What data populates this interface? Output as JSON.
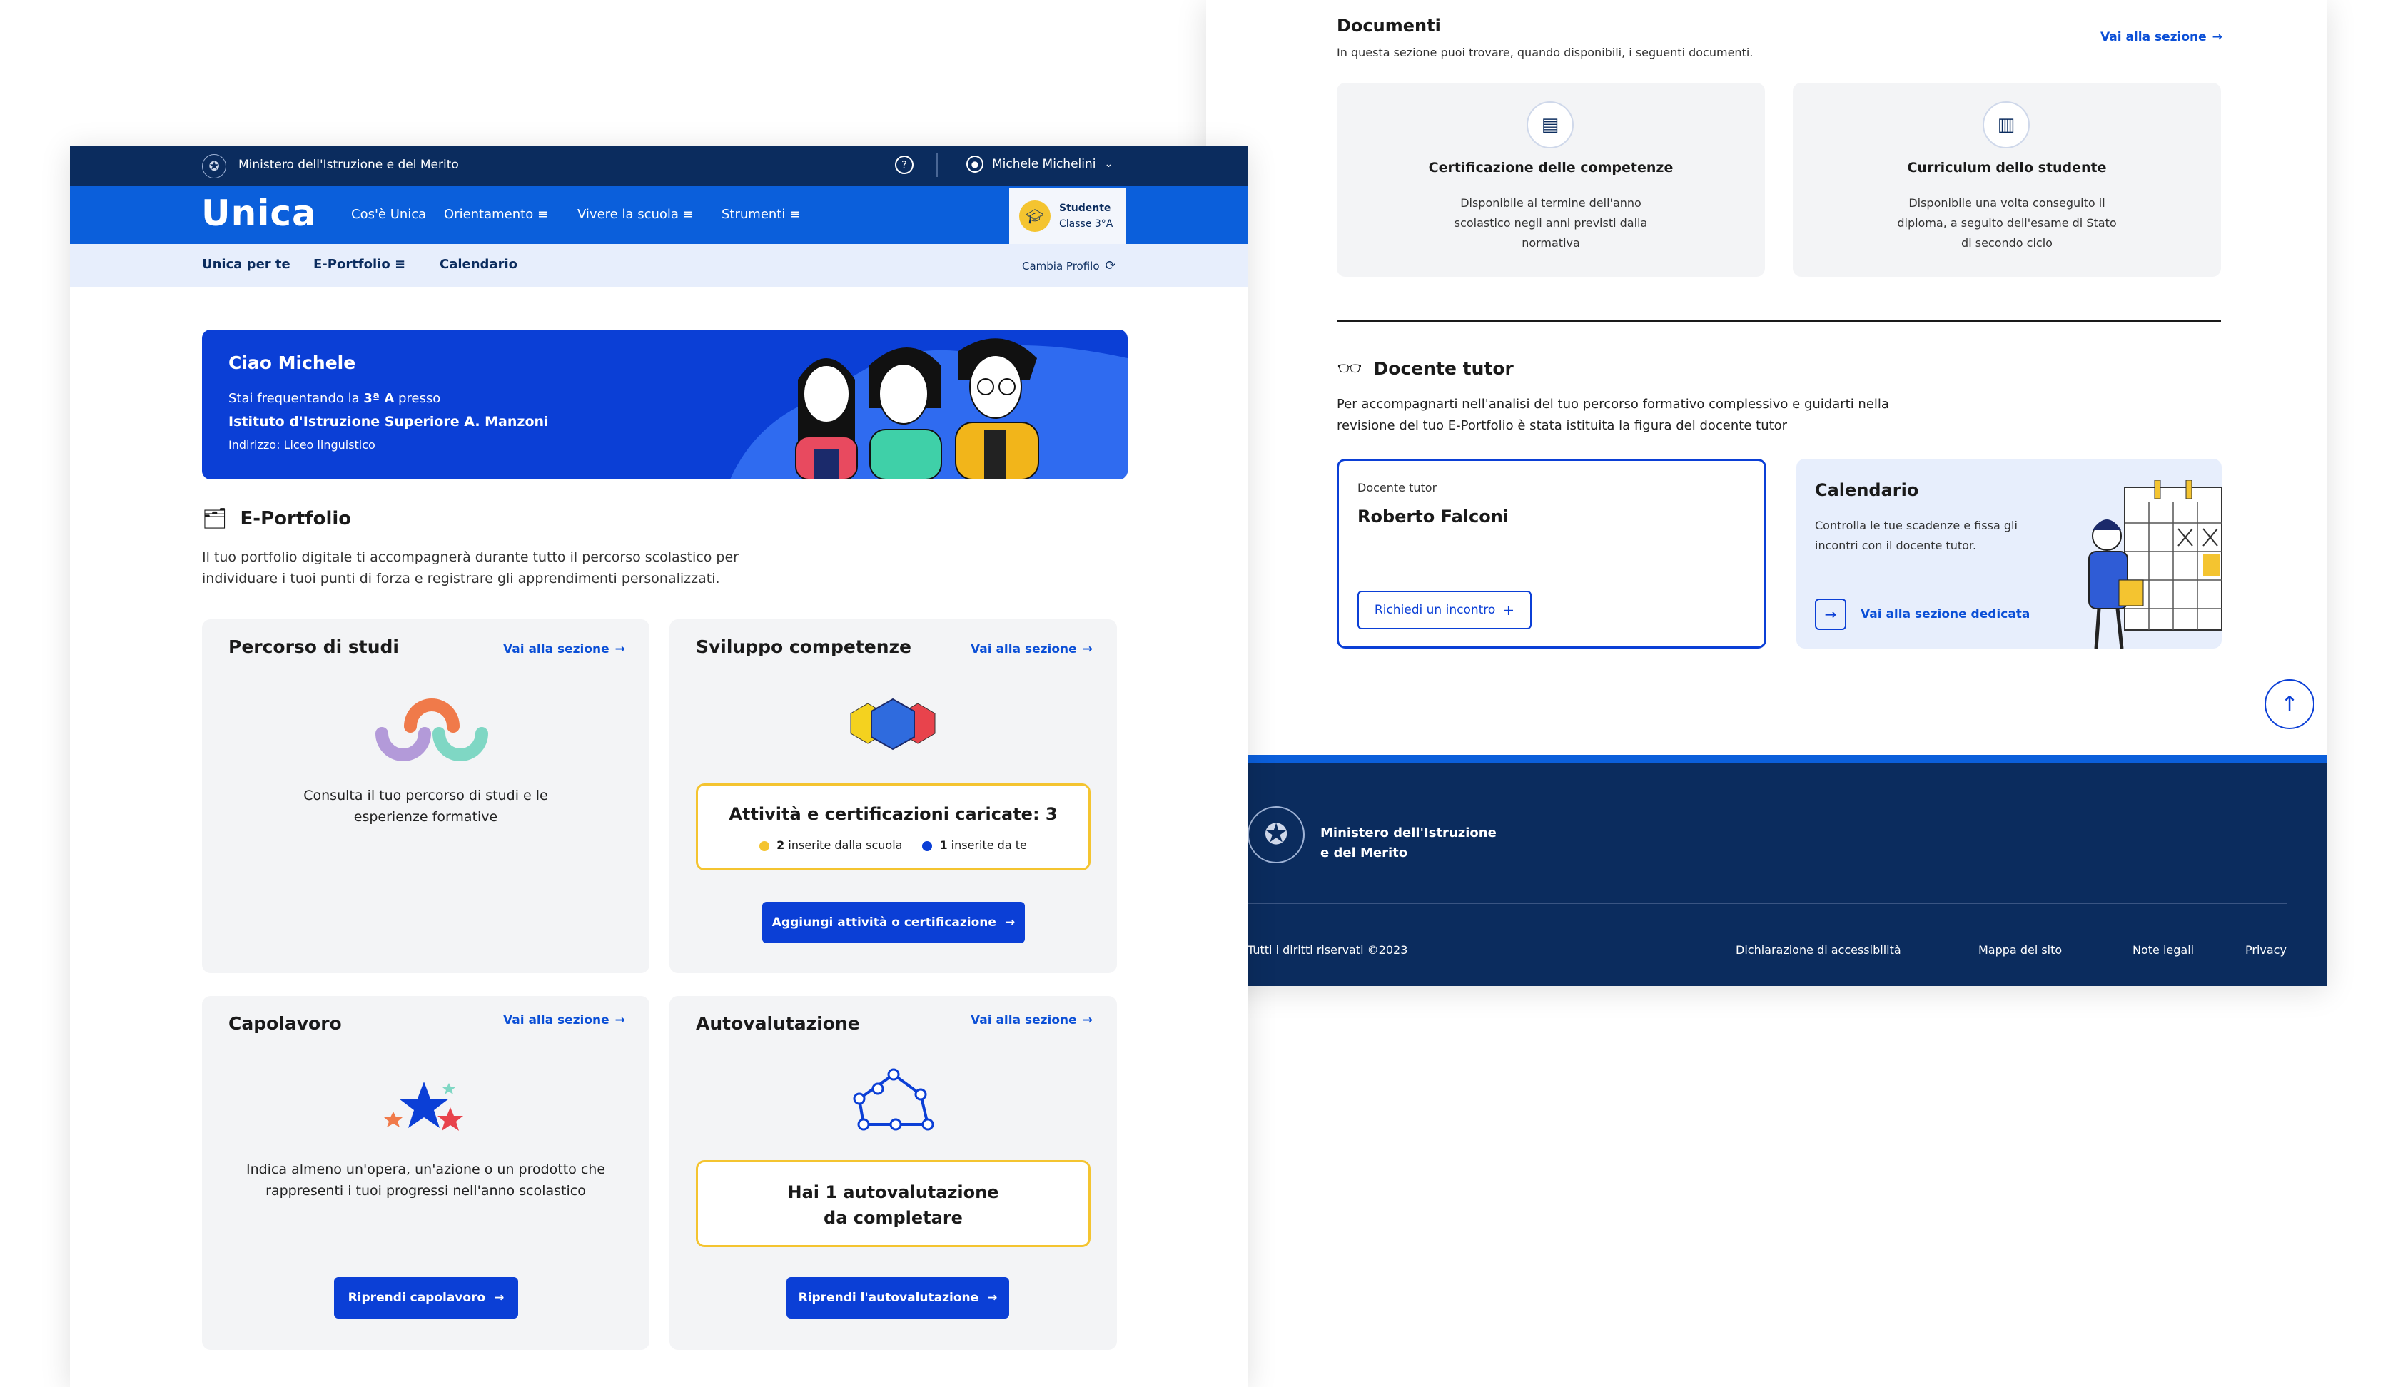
{
  "right": {
    "documenti": {
      "title": "Documenti",
      "subtitle": "In questa sezione puoi trovare, quando disponibili, i seguenti documenti.",
      "link": "Vai alla sezione",
      "cards": [
        {
          "title": "Certificazione delle competenze",
          "text": [
            "Disponibile al termine dell'anno",
            "scolastico negli anni previsti dalla",
            "normativa"
          ]
        },
        {
          "title": "Curriculum dello studente",
          "text": [
            "Disponibile una volta conseguito il",
            "diploma, a seguito dell'esame di Stato",
            "di secondo ciclo"
          ]
        }
      ]
    },
    "tutor": {
      "title": "Docente tutor",
      "desc1": "Per accompagnarti nell'analisi del tuo percorso formativo complessivo e guidarti nella",
      "desc2": "revisione del tuo E-Portfolio è stata istituita la figura del docente tutor",
      "label": "Docente tutor",
      "name": "Roberto Falconi",
      "button": "Richiedi un incontro"
    },
    "calendario": {
      "title": "Calendario",
      "text1": "Controlla le tue scadenze e fissa gli",
      "text2": "incontri con il docente tutor.",
      "link": "Vai alla sezione dedicata"
    },
    "footer": {
      "ministry1": "Ministero dell'Istruzione",
      "ministry2": "e del Merito",
      "copyright": "Tutti i diritti riservati ©2023",
      "links": [
        "Dichiarazione di accessibilità",
        "Mappa del sito",
        "Note legali",
        "Privacy"
      ]
    }
  },
  "left": {
    "topbar": {
      "ministry": "Ministero dell'Istruzione e del Merito",
      "user": "Michele Michelini"
    },
    "nav": {
      "logo": "Unica",
      "items": [
        "Cos'è Unica",
        "Orientamento",
        "Vivere la scuola",
        "Strumenti"
      ],
      "profile_role": "Studente",
      "profile_class": "Classe 3°A"
    },
    "subnav": {
      "items": [
        "Unica per te",
        "E-Portfolio",
        "Calendario"
      ],
      "change_profile": "Cambia Profilo"
    },
    "hero": {
      "greeting": "Ciao Michele",
      "line_prefix": "Stai frequentando la ",
      "line_class": "3ª A",
      "line_suffix": " presso",
      "school": "Istituto d'Istruzione Superiore A. Manzoni",
      "address": "Indirizzo: Liceo linguistico"
    },
    "eportfolio": {
      "title": "E-Portfolio",
      "desc1": "Il tuo portfolio digitale ti accompagnerà durante tutto il percorso scolastico per",
      "desc2": "individuare i tuoi punti di forza e registrare gli apprendimenti personalizzati."
    },
    "cards": {
      "link": "Vai alla sezione",
      "percorso": {
        "title": "Percorso di studi",
        "text1": "Consulta il tuo percorso di studi e le",
        "text2": "esperienze formative"
      },
      "sviluppo": {
        "title": "Sviluppo competenze",
        "box_title": "Attività e certificazioni caricate: 3",
        "school_count": "2",
        "school_label": "inserite dalla scuola",
        "self_count": "1",
        "self_label": "inserite da te",
        "button": "Aggiungi attività o certificazione"
      },
      "capolavoro": {
        "title": "Capolavoro",
        "text1": "Indica almeno un'opera, un'azione o un prodotto che",
        "text2": "rappresenti i tuoi progressi nell'anno scolastico",
        "button": "Riprendi capolavoro"
      },
      "autovalutazione": {
        "title": "Autovalutazione",
        "box1": "Hai 1 autovalutazione",
        "box2": "da completare",
        "button": "Riprendi l'autovalutazione"
      }
    }
  },
  "colors": {
    "navy": "#0b2c5e",
    "blue": "#0b5fdb",
    "accent": "#0b3fd6",
    "yellow": "#f4c430"
  }
}
